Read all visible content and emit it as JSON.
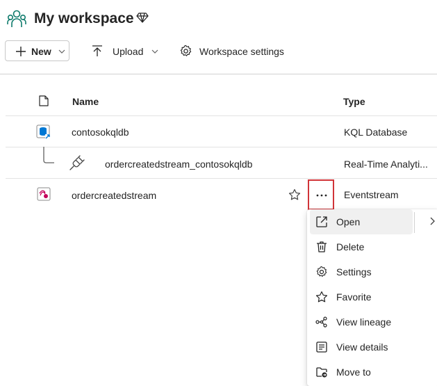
{
  "header": {
    "title": "My workspace"
  },
  "toolbar": {
    "new_label": "New",
    "upload_label": "Upload",
    "workspace_settings_label": "Workspace settings"
  },
  "table": {
    "columns": [
      "Name",
      "Type"
    ],
    "rows": [
      {
        "name": "contosokqldb",
        "type": "KQL Database",
        "icon": "kql-database-icon"
      },
      {
        "name": "ordercreatedstream_contosokqldb",
        "type": "Real-Time Analyti...",
        "icon": "plug-icon"
      },
      {
        "name": "ordercreatedstream",
        "type": "Eventstream",
        "icon": "eventstream-icon"
      }
    ]
  },
  "context_menu": {
    "items": [
      {
        "label": "Open",
        "icon": "open-external-icon"
      },
      {
        "label": "Delete",
        "icon": "trash-icon"
      },
      {
        "label": "Settings",
        "icon": "gear-icon"
      },
      {
        "label": "Favorite",
        "icon": "star-icon"
      },
      {
        "label": "View lineage",
        "icon": "lineage-icon"
      },
      {
        "label": "View details",
        "icon": "details-icon"
      },
      {
        "label": "Move to",
        "icon": "move-to-folder-icon"
      }
    ]
  },
  "colors": {
    "accent": "#107c10",
    "highlight_border": "#d13438",
    "kql_blue": "#0078d4",
    "eventstream_pink": "#c3005a"
  }
}
